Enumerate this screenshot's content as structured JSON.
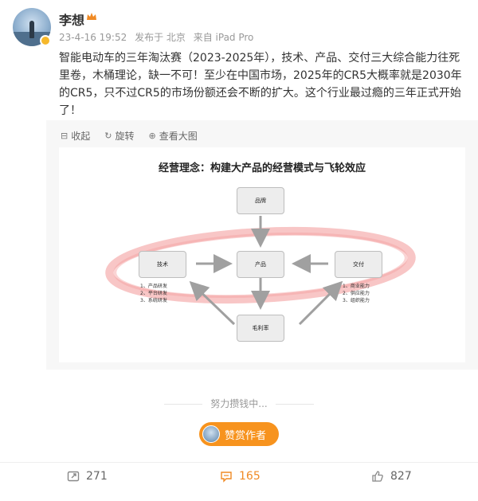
{
  "author": {
    "name": "李想"
  },
  "post": {
    "meta": {
      "time": "23-4-16 19:52",
      "location": "发布于 北京",
      "source": "来自 iPad Pro"
    },
    "text": "智能电动车的三年淘汰赛（2023-2025年），技术、产品、交付三大综合能力往死里卷，木桶理论，缺一不可！至少在中国市场，2025年的CR5大概率就是2030年的CR5，只不过CR5的市场份额还会不断的扩大。这个行业最过瘾的三年正式开始了！"
  },
  "media_toolbar": {
    "collect": "收起",
    "rotate": "旋转",
    "view_large": "查看大图"
  },
  "diagram": {
    "title": "经营理念：构建大产品的经营模式与飞轮效应",
    "nodes": {
      "brand": "品牌",
      "tech": "技术",
      "product": "产品",
      "delivery": "交付",
      "margin": "毛利率"
    },
    "tech_list": [
      "1、产品研发",
      "2、平台研发",
      "3、系统研发"
    ],
    "delivery_list": [
      "1、商业能力",
      "2、供应能力",
      "3、组织能力"
    ]
  },
  "loading_text": "努力攒钱中...",
  "reward_label": "赞赏作者",
  "actions": {
    "repost_count": "271",
    "comment_count": "165",
    "like_count": "827"
  },
  "colors": {
    "accent": "#f7931e",
    "comment_active": "#f08a24",
    "highlight_ring": "#f08080"
  },
  "icons": {
    "repost": "repost-icon",
    "comment": "comment-icon",
    "like": "like-icon"
  }
}
